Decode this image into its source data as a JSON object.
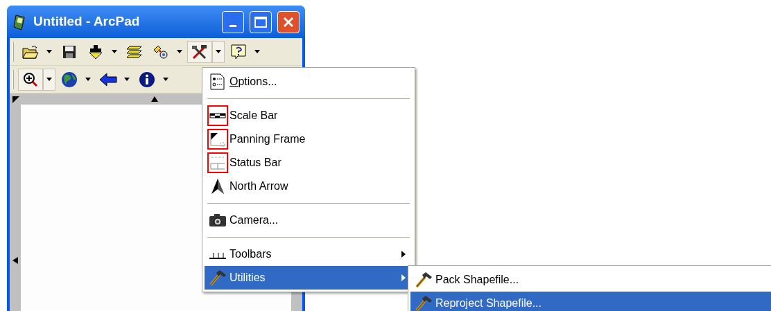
{
  "window": {
    "title": "Untitled - ArcPad"
  },
  "toolbars": [
    {
      "buttons": [
        {
          "pressed": false,
          "dropdown": true
        },
        {
          "pressed": false,
          "dropdown": false
        },
        {
          "pressed": false,
          "dropdown": true
        },
        {
          "pressed": false,
          "dropdown": false
        },
        {
          "pressed": false,
          "dropdown": true
        },
        {
          "pressed": true,
          "dropdown": true
        },
        {
          "pressed": false,
          "dropdown": true
        }
      ]
    },
    {
      "buttons": [
        {
          "pressed": true,
          "dropdown": true
        },
        {
          "pressed": false,
          "dropdown": true
        },
        {
          "pressed": false,
          "dropdown": true
        },
        {
          "pressed": false,
          "dropdown": true
        }
      ]
    }
  ],
  "menu": {
    "items": [
      {
        "kind": "command",
        "label": "Options...",
        "underline_first": true,
        "selected": false
      },
      {
        "kind": "separator"
      },
      {
        "kind": "toggle",
        "label": "Scale Bar",
        "checked": true,
        "selected": false
      },
      {
        "kind": "toggle",
        "label": "Panning Frame",
        "checked": true,
        "selected": false
      },
      {
        "kind": "toggle",
        "label": "Status Bar",
        "checked": true,
        "selected": false
      },
      {
        "kind": "toggle",
        "label": "North Arrow",
        "checked": false,
        "selected": false
      },
      {
        "kind": "separator"
      },
      {
        "kind": "command",
        "label": "Camera...",
        "underline_first": false,
        "selected": false
      },
      {
        "kind": "separator"
      },
      {
        "kind": "submenu",
        "label": "Toolbars",
        "selected": false
      },
      {
        "kind": "submenu",
        "label": "Utilities",
        "selected": true
      }
    ]
  },
  "submenu": {
    "items": [
      {
        "label": "Pack Shapefile...",
        "selected": false
      },
      {
        "label": "Reproject Shapefile...",
        "selected": true
      }
    ]
  }
}
